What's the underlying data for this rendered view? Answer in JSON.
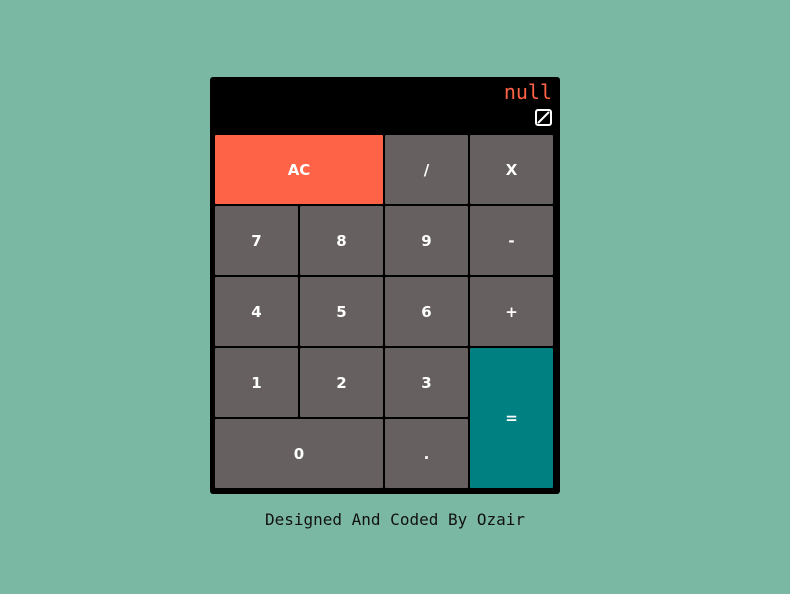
{
  "display": {
    "value": "null",
    "icon": "edit-square-icon"
  },
  "keys": {
    "clear": "AC",
    "divide": "/",
    "multiply": "X",
    "seven": "7",
    "eight": "8",
    "nine": "9",
    "subtract": "-",
    "four": "4",
    "five": "5",
    "six": "6",
    "add": "+",
    "one": "1",
    "two": "2",
    "three": "3",
    "equals": "=",
    "zero": "0",
    "decimal": "."
  },
  "footer": {
    "credit": "Designed And Coded By Ozair"
  },
  "colors": {
    "background": "#7ab8a4",
    "clear_button": "#ff6347",
    "equals_button": "#008080",
    "number_button": "#676060",
    "display_text": "#ff6347"
  }
}
